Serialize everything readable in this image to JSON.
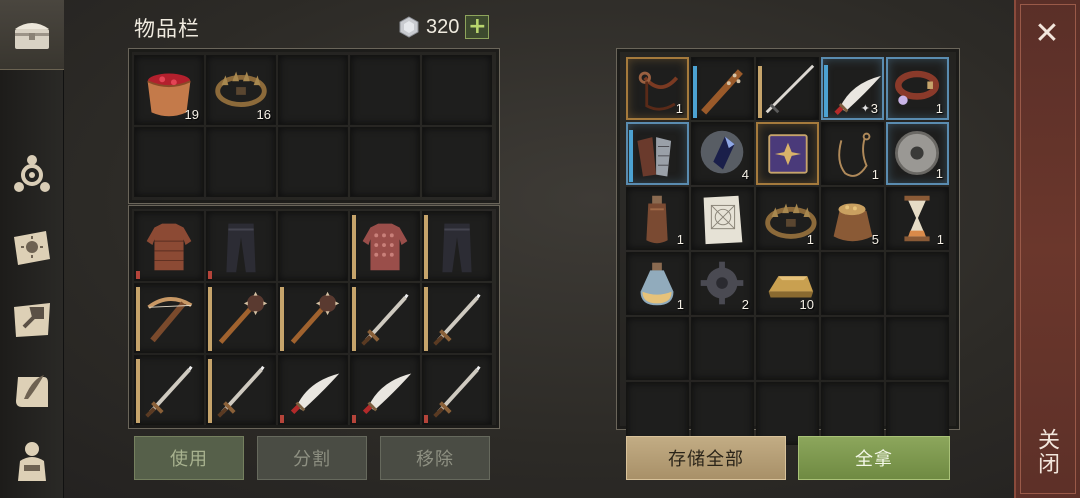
{
  "title": "物品栏",
  "currency": {
    "icon": "gem-icon",
    "value": "320",
    "add_label": "+"
  },
  "close": {
    "icon": "close-icon",
    "label": "关闭"
  },
  "sidebar": {
    "items": [
      {
        "icon": "chest-icon",
        "active": true
      },
      {
        "icon": "skill-node-icon"
      },
      {
        "icon": "sun-book-icon"
      },
      {
        "icon": "hammer-map-icon"
      },
      {
        "icon": "quill-scroll-icon"
      },
      {
        "icon": "character-icon"
      }
    ]
  },
  "inventory": {
    "rows": [
      [
        {
          "item": "berry-bucket",
          "count": "19"
        },
        {
          "item": "bear-trap",
          "count": "16"
        },
        {},
        {},
        {}
      ],
      [
        {},
        {},
        {},
        {},
        {}
      ]
    ]
  },
  "equipment": {
    "rows": [
      [
        {
          "item": "leather-tunic",
          "bar": "red"
        },
        {
          "item": "dark-pants",
          "bar": "red"
        },
        {},
        {
          "item": "chainmail-tunic",
          "bar": "gold"
        },
        {
          "item": "dark-pants",
          "bar": "gold"
        }
      ],
      [
        {
          "item": "crossbow",
          "bar": "gold"
        },
        {
          "item": "spiked-mace",
          "bar": "gold"
        },
        {
          "item": "spiked-mace",
          "bar": "gold"
        },
        {
          "item": "sword",
          "bar": "gold"
        },
        {
          "item": "sword",
          "bar": "gold"
        }
      ],
      [
        {
          "item": "sword",
          "bar": "gold"
        },
        {
          "item": "sword",
          "bar": "gold"
        },
        {
          "item": "scimitar",
          "bar": "red"
        },
        {
          "item": "scimitar",
          "bar": "red"
        },
        {
          "item": "sword",
          "bar": "red"
        }
      ]
    ]
  },
  "storage": {
    "rows": [
      [
        {
          "item": "leather-strap",
          "count": "1",
          "quality": "rare"
        },
        {
          "item": "spiked-club",
          "bar": "blue"
        },
        {
          "item": "long-sword",
          "bar": "gold"
        },
        {
          "item": "scimitar",
          "count": "3",
          "quality": "magic",
          "bar": "blue",
          "sub": "✦"
        },
        {
          "item": "collar",
          "count": "1",
          "quality": "magic"
        }
      ],
      [
        {
          "item": "gauntlets",
          "quality": "magic",
          "bar": "blue"
        },
        {
          "item": "crystal",
          "count": "4"
        },
        {
          "item": "purple-book",
          "quality": "rare"
        },
        {
          "item": "rope",
          "count": "1"
        },
        {
          "item": "grindstone",
          "count": "1",
          "quality": "magic"
        }
      ],
      [
        {
          "item": "flask",
          "count": "1"
        },
        {
          "item": "blueprint"
        },
        {
          "item": "bear-trap",
          "count": "1"
        },
        {
          "item": "sack",
          "count": "5"
        },
        {
          "item": "hourglass",
          "count": "1"
        }
      ],
      [
        {
          "item": "potion",
          "count": "1"
        },
        {
          "item": "gear",
          "count": "2"
        },
        {
          "item": "ingot",
          "count": "10"
        },
        {},
        {}
      ],
      [
        {},
        {},
        {},
        {},
        {}
      ],
      [
        {},
        {},
        {},
        {},
        {}
      ]
    ]
  },
  "buttons": {
    "use": "使用",
    "split": "分割",
    "remove": "移除",
    "store_all": "存储全部",
    "take_all": "全拿"
  },
  "colors": {
    "bar_gold": "#c6a46b",
    "bar_red": "#b5443a",
    "bar_blue": "#4ca2d2",
    "take_green": "#7e9850",
    "store_tan": "#b59e76",
    "close_red": "#6b372c"
  }
}
